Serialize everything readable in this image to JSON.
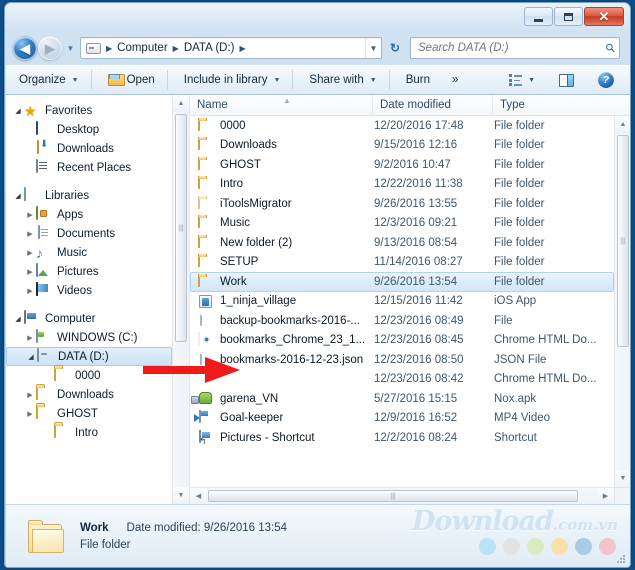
{
  "window": {
    "caption_buttons": {
      "minimize": "—",
      "maximize": "□",
      "close": "✕"
    }
  },
  "address": {
    "back_icon": "◀",
    "forward_icon": "▶",
    "history_caret": "▼",
    "computer_crumb": "Computer",
    "drive_crumb": "DATA (D:)",
    "separator": "▶",
    "dropdown_caret": "▼",
    "refresh_icon": "↻"
  },
  "search": {
    "placeholder": "Search DATA (D:)",
    "value": "",
    "icon": "search-icon"
  },
  "toolbar": {
    "organize": "Organize",
    "open": "Open",
    "include_in_library": "Include in library",
    "share_with": "Share with",
    "burn": "Burn",
    "overflow": "»",
    "views_caret": "▼",
    "help": "?",
    "caret": "▼"
  },
  "sidebar": {
    "groups": [
      {
        "label": "Favorites",
        "icon": "star-icon",
        "expanded": true,
        "items": [
          {
            "label": "Desktop",
            "icon": "desktop-icon"
          },
          {
            "label": "Downloads",
            "icon": "downloads-icon"
          },
          {
            "label": "Recent Places",
            "icon": "recent-places-icon"
          }
        ]
      },
      {
        "label": "Libraries",
        "icon": "libraries-icon",
        "expanded": true,
        "items": [
          {
            "label": "Apps",
            "icon": "apps-icon",
            "chevron": "▶"
          },
          {
            "label": "Documents",
            "icon": "documents-icon",
            "chevron": "▶"
          },
          {
            "label": "Music",
            "icon": "music-icon",
            "chevron": "▶"
          },
          {
            "label": "Pictures",
            "icon": "pictures-icon",
            "chevron": "▶"
          },
          {
            "label": "Videos",
            "icon": "videos-icon",
            "chevron": "▶"
          }
        ]
      },
      {
        "label": "Computer",
        "icon": "computer-icon",
        "expanded": true,
        "items": [
          {
            "label": "WINDOWS (C:)",
            "icon": "drive-c-icon",
            "chevron": "▶"
          },
          {
            "label": "DATA (D:)",
            "icon": "drive-d-icon",
            "chevron": "◢",
            "selected": true
          },
          {
            "label": "0000",
            "icon": "folder-icon"
          },
          {
            "label": "Downloads",
            "icon": "folder-icon",
            "chevron": "▶"
          },
          {
            "label": "GHOST",
            "icon": "folder-icon",
            "chevron": "▶"
          },
          {
            "label": "Intro",
            "icon": "folder-icon"
          }
        ]
      }
    ]
  },
  "filelist": {
    "columns": {
      "name": "Name",
      "date_modified": "Date modified",
      "type": "Type"
    },
    "sort_indicator": "▲",
    "rows": [
      {
        "name": "0000",
        "date": "12/20/2016 17:48",
        "type": "File folder",
        "icon": "folder-icon"
      },
      {
        "name": "Downloads",
        "date": "9/15/2016 12:16",
        "type": "File folder",
        "icon": "folder-icon"
      },
      {
        "name": "GHOST",
        "date": "9/2/2016 10:47",
        "type": "File folder",
        "icon": "folder-icon"
      },
      {
        "name": "Intro",
        "date": "12/22/2016 11:38",
        "type": "File folder",
        "icon": "folder-icon"
      },
      {
        "name": "iToolsMigrator",
        "date": "9/26/2016 13:55",
        "type": "File folder",
        "icon": "folder-pale-icon"
      },
      {
        "name": "Music",
        "date": "12/3/2016 09:21",
        "type": "File folder",
        "icon": "folder-icon"
      },
      {
        "name": "New folder (2)",
        "date": "9/13/2016 08:54",
        "type": "File folder",
        "icon": "folder-icon"
      },
      {
        "name": "SETUP",
        "date": "11/14/2016 08:27",
        "type": "File folder",
        "icon": "folder-icon"
      },
      {
        "name": "Work",
        "date": "9/26/2016 13:54",
        "type": "File folder",
        "icon": "folder-icon",
        "selected": true
      },
      {
        "name": "1_ninja_village",
        "date": "12/15/2016 11:42",
        "type": "iOS App",
        "icon": "ios-app-icon"
      },
      {
        "name": "backup-bookmarks-2016-...",
        "date": "12/23/2016 08:49",
        "type": "File",
        "icon": "blank-file-icon"
      },
      {
        "name": "bookmarks_Chrome_23_1...",
        "date": "12/23/2016 08:45",
        "type": "Chrome HTML Do...",
        "icon": "chrome-icon"
      },
      {
        "name": "bookmarks-2016-12-23.json",
        "date": "12/23/2016 08:50",
        "type": "JSON File",
        "icon": "blank-file-icon"
      },
      {
        "name": "",
        "date": "12/23/2016 08:42",
        "type": "Chrome HTML Do...",
        "icon": "none"
      },
      {
        "name": "garena_VN",
        "date": "5/27/2016 15:15",
        "type": "Nox.apk",
        "icon": "apk-icon"
      },
      {
        "name": "Goal-keeper",
        "date": "12/9/2016 16:52",
        "type": "MP4 Video",
        "icon": "mp4-icon"
      },
      {
        "name": "Pictures - Shortcut",
        "date": "12/2/2016 08:24",
        "type": "Shortcut",
        "icon": "shortcut-icon"
      }
    ]
  },
  "details": {
    "name": "Work",
    "date_label": "Date modified:",
    "date_value": "9/26/2016 13:54",
    "type": "File folder"
  },
  "watermark": {
    "text": "Download",
    "suffix": ".com.vn",
    "dots": [
      "#b9e2f5",
      "#dfe3e6",
      "#d9ecc0",
      "#fbdfa8",
      "#a9cbe6",
      "#f3c3c9"
    ]
  },
  "scrollbar": {
    "up": "▲",
    "down": "▼",
    "left": "◀",
    "right": "▶",
    "grip": "|||"
  }
}
